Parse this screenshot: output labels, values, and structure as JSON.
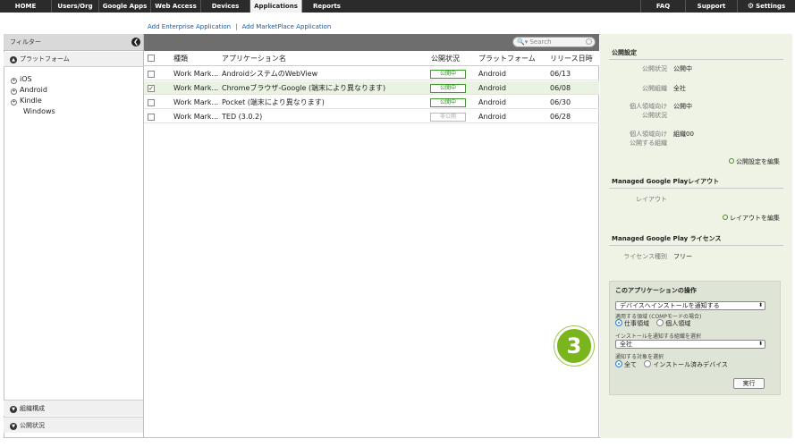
{
  "topnav": {
    "left_tabs": [
      "HOME",
      "Users/Org",
      "Google Apps",
      "Web Access",
      "Devices",
      "Applications",
      "Reports"
    ],
    "active_tab": "Applications",
    "right_tabs": [
      "FAQ",
      "Support",
      "Settings"
    ]
  },
  "links": {
    "add_enterprise": "Add Enterprise Application",
    "separator": "|",
    "add_marketplace": "Add MarketPlace Application"
  },
  "sidebar": {
    "filter_label": "フィルター",
    "platform_label": "プラットフォーム",
    "platform_items": [
      "iOS",
      "Android",
      "Kindle",
      "Windows"
    ],
    "org_label": "組織構成",
    "status_label": "公開状況"
  },
  "table": {
    "search_placeholder": "Search",
    "columns": [
      "種類",
      "アプリケーション名",
      "公開状況",
      "プラットフォーム",
      "リリース日時"
    ],
    "rows": [
      {
        "kind": "Work Mark...",
        "name": "AndroidシステムのWebView",
        "status": "公開中",
        "platform": "Android",
        "date": "06/13",
        "checked": false,
        "published": true
      },
      {
        "kind": "Work Mark...",
        "name": "Chromeブラウザ-Google (端末により異なります)",
        "status": "公開中",
        "platform": "Android",
        "date": "06/08",
        "checked": true,
        "published": true
      },
      {
        "kind": "Work Mark...",
        "name": "Pocket (端末により異なります)",
        "status": "公開中",
        "platform": "Android",
        "date": "06/30",
        "checked": false,
        "published": true
      },
      {
        "kind": "Work Mark...",
        "name": "TED (3.0.2)",
        "status": "非公開",
        "platform": "Android",
        "date": "06/28",
        "checked": false,
        "published": false
      }
    ]
  },
  "panel": {
    "publish_title": "公開設定",
    "pub_status_label": "公開状況",
    "pub_status_value": "公開中",
    "pub_org_label": "公開組織",
    "pub_org_value": "全社",
    "personal_status_label_1": "個人領域向け",
    "personal_status_label_2": "公開状況",
    "personal_status_value": "公開中",
    "personal_org_label_1": "個人領域向け",
    "personal_org_label_2": "公開する組織",
    "personal_org_value": "組織00",
    "edit_publish": "公開設定を編集",
    "layout_title": "Managed Google Playレイアウト",
    "layout_label": "レイアウト",
    "edit_layout": "レイアウトを編集",
    "license_title": "Managed Google Play ライセンス",
    "license_label": "ライセンス種別",
    "license_value": "フリー",
    "op_title": "このアプリケーションの操作",
    "op_select": "デバイスへインストールを通知する",
    "domain_label": "適用する領域 (COMPモードの場合)",
    "domain_work": "仕事領域",
    "domain_personal": "個人領域",
    "org_select_label": "インストールを通知する組織を選択",
    "org_select": "全社",
    "target_label": "通知する対象を選択",
    "target_all": "全て",
    "target_installed": "インストール済みデバイス",
    "run_label": "実行"
  },
  "step_number": "3",
  "colors": {
    "accent_green": "#7ab51d",
    "nav_dark": "#2b2b2b",
    "panel_bg": "#eef3e5"
  }
}
